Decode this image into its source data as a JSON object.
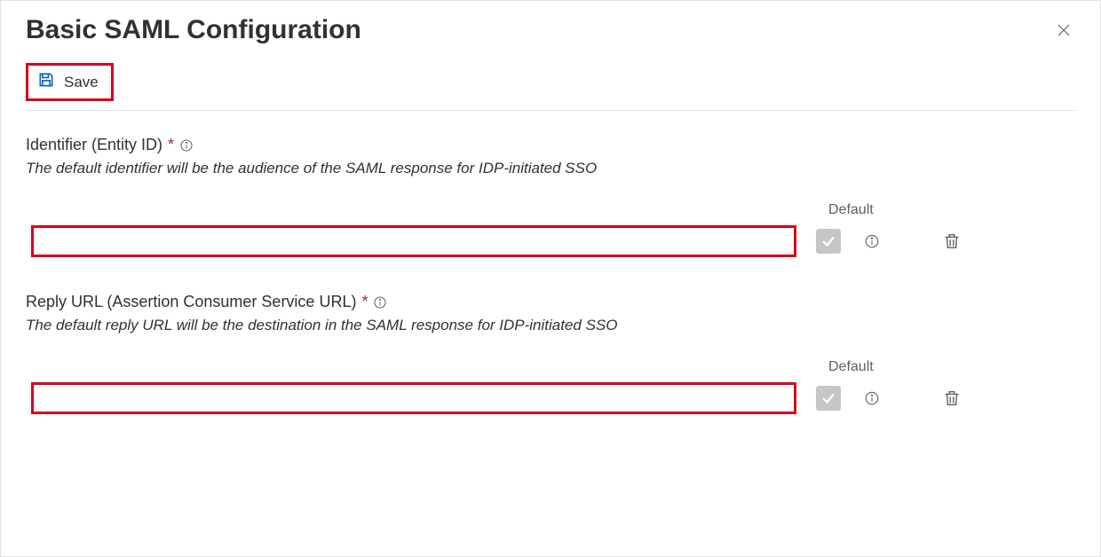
{
  "header": {
    "title": "Basic SAML Configuration"
  },
  "toolbar": {
    "save_label": "Save"
  },
  "columns": {
    "default_label": "Default"
  },
  "sections": {
    "identifier": {
      "label": "Identifier (Entity ID)",
      "required_marker": "*",
      "description": "The default identifier will be the audience of the SAML response for IDP-initiated SSO",
      "value": ""
    },
    "reply_url": {
      "label": "Reply URL (Assertion Consumer Service URL)",
      "required_marker": "*",
      "description": "The default reply URL will be the destination in the SAML response for IDP-initiated SSO",
      "value": ""
    }
  }
}
